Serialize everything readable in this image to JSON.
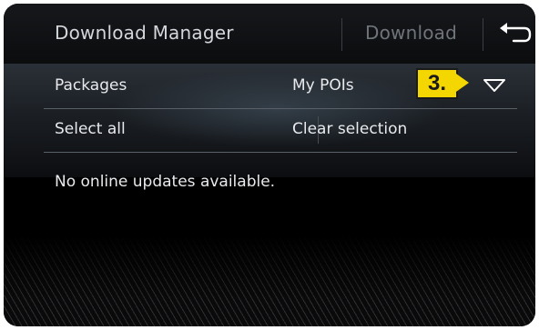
{
  "header": {
    "title": "Download Manager",
    "download_label": "Download",
    "back_icon": "return-arrow-icon"
  },
  "filters": {
    "packages_label": "Packages",
    "selected_package": "My POIs",
    "dropdown_icon": "chevron-down-icon"
  },
  "actions": {
    "select_all_label": "Select all",
    "clear_selection_label": "Clear selection"
  },
  "status": {
    "message": "No online updates available."
  },
  "callout": {
    "label": "3.",
    "color": "#f4d600"
  },
  "colors": {
    "text": "#e8eaed",
    "title": "#d3d6db",
    "disabled": "#6f747b",
    "background": "#000000"
  }
}
